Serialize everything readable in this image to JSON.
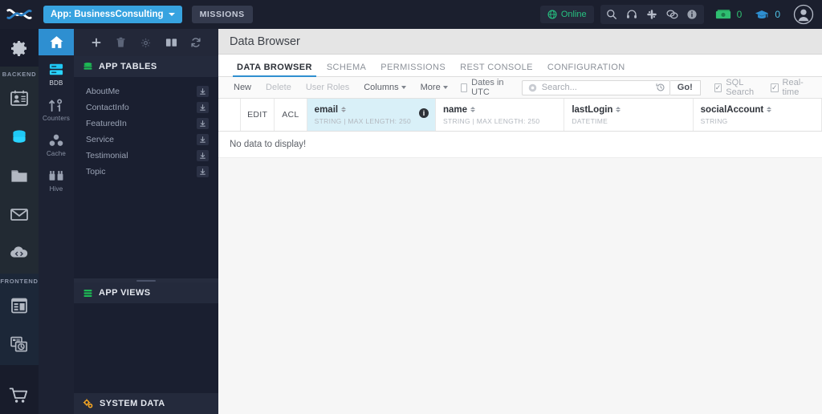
{
  "topbar": {
    "logo": "backendless-logo",
    "app_selector": {
      "label": "App: BusinessConsulting",
      "icon": "chevron-down-icon"
    },
    "missions_label": "MISSIONS",
    "status": {
      "label": "Online",
      "icon": "globe-icon",
      "color": "#26c281"
    },
    "icons": [
      "search-icon",
      "headset-icon",
      "slack-icon",
      "chat-icon",
      "info-icon"
    ],
    "counters": [
      {
        "icon": "cash-icon",
        "value": "0",
        "color": "#2fbf71"
      },
      {
        "icon": "graduation-cap-icon",
        "value": "0",
        "color": "#4fc3e8"
      }
    ],
    "avatar": "user-avatar-icon"
  },
  "nav_primary": {
    "settings_label": "gear-icon",
    "sections": [
      {
        "label": "BACKEND",
        "items": [
          {
            "name": "users",
            "icon": "users-card-icon",
            "active": false
          },
          {
            "name": "data",
            "icon": "database-icon",
            "active": true
          },
          {
            "name": "files",
            "icon": "folder-icon",
            "active": false
          },
          {
            "name": "messaging",
            "icon": "envelope-icon",
            "active": false
          },
          {
            "name": "cloud-code",
            "icon": "cloud-code-icon",
            "active": false
          }
        ]
      },
      {
        "label": "FRONTEND",
        "items": [
          {
            "name": "ui-builder",
            "icon": "layout-icon",
            "active": false
          },
          {
            "name": "app-preview",
            "icon": "app-clock-icon",
            "active": false
          }
        ]
      }
    ],
    "marketplace": {
      "name": "marketplace",
      "icon": "cart-icon"
    }
  },
  "nav_secondary": {
    "home": "home-icon",
    "items": [
      {
        "label": "BDB",
        "icon": "bdb-icon",
        "active": true
      },
      {
        "label": "Counters",
        "icon": "counters-icon",
        "active": false
      },
      {
        "label": "Cache",
        "icon": "cache-icon",
        "active": false
      },
      {
        "label": "Hive",
        "icon": "hive-icon",
        "active": false
      }
    ]
  },
  "panel": {
    "toolbar": [
      {
        "name": "add-table",
        "icon": "plus-icon"
      },
      {
        "name": "delete-table",
        "icon": "trash-icon"
      },
      {
        "name": "table-settings",
        "icon": "gear-icon"
      },
      {
        "name": "table-columns",
        "icon": "book-icon"
      },
      {
        "name": "refresh-tables",
        "icon": "refresh-icon"
      }
    ],
    "app_tables": {
      "title": "APP TABLES",
      "icon": "database-green-icon",
      "tables": [
        {
          "name": "AboutMe"
        },
        {
          "name": "ContactInfo"
        },
        {
          "name": "FeaturedIn"
        },
        {
          "name": "Service"
        },
        {
          "name": "Testimonial"
        },
        {
          "name": "Topic"
        }
      ]
    },
    "app_views": {
      "title": "APP VIEWS",
      "icon": "views-green-icon"
    },
    "system_data": {
      "title": "SYSTEM DATA",
      "icon": "gears-orange-icon"
    }
  },
  "main": {
    "page_title": "Data Browser",
    "tabs": [
      {
        "label": "DATA BROWSER",
        "active": true
      },
      {
        "label": "SCHEMA",
        "active": false
      },
      {
        "label": "PERMISSIONS",
        "active": false
      },
      {
        "label": "REST CONSOLE",
        "active": false
      },
      {
        "label": "CONFIGURATION",
        "active": false
      }
    ],
    "toolbar": {
      "new_label": "New",
      "delete_label": "Delete",
      "user_roles_label": "User Roles",
      "columns_label": "Columns",
      "more_label": "More",
      "dates_utc_label": "Dates in UTC",
      "dates_utc_checked": false,
      "search_placeholder": "Search...",
      "search_value": "",
      "search_icon": "clear-circle-icon",
      "history_icon": "history-icon",
      "go_label": "Go!",
      "sql_search_label": "SQL Search",
      "sql_search_checked": true,
      "realtime_label": "Real-time",
      "realtime_checked": true
    },
    "grid": {
      "fixed_columns": [
        {
          "label": "EDIT"
        },
        {
          "label": "ACL"
        }
      ],
      "columns": [
        {
          "name": "email",
          "type": "STRING | MAX LENGTH: 250",
          "highlighted": true,
          "info": "i"
        },
        {
          "name": "name",
          "type": "STRING | MAX LENGTH: 250",
          "highlighted": false
        },
        {
          "name": "lastLogin",
          "type": "DATETIME",
          "highlighted": false
        },
        {
          "name": "socialAccount",
          "type": "STRING",
          "highlighted": false
        }
      ],
      "empty_message": "No data to display!"
    }
  }
}
